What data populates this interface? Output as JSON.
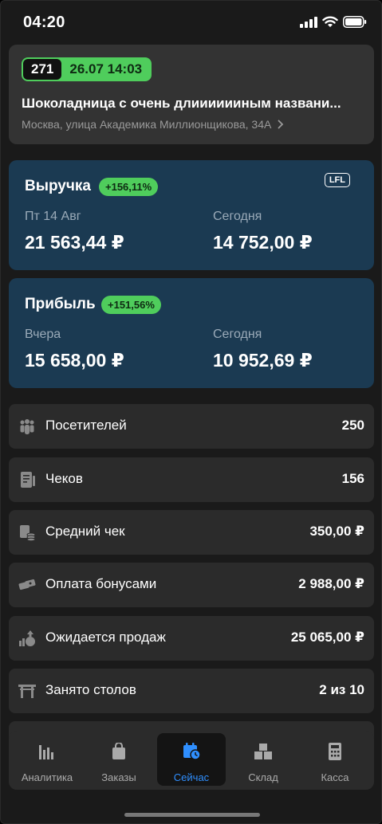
{
  "status": {
    "time": "04:20"
  },
  "store": {
    "number": "271",
    "datetime": "26.07  14:03",
    "name": "Шоколадница с очень длииииииным названи...",
    "address": "Москва, улица Академика Миллионщикова, 34А"
  },
  "revenue": {
    "title": "Выручка",
    "change": "+156,11%",
    "lfl": "LFL",
    "left_label": "Пт 14 Авг",
    "left_value": "21 563,44 ₽",
    "right_label": "Сегодня",
    "right_value": "14 752,00 ₽"
  },
  "profit": {
    "title": "Прибыль",
    "change": "+151,56%",
    "left_label": "Вчера",
    "left_value": "15 658,00 ₽",
    "right_label": "Сегодня",
    "right_value": "10 952,69 ₽"
  },
  "rows": [
    {
      "icon": "visitors-icon",
      "label": "Посетителей",
      "value": "250"
    },
    {
      "icon": "receipt-icon",
      "label": "Чеков",
      "value": "156"
    },
    {
      "icon": "wallet-coins-icon",
      "label": "Средний чек",
      "value": "350,00 ₽"
    },
    {
      "icon": "bonus-tickets-icon",
      "label": "Оплата бонусами",
      "value": "2 988,00 ₽"
    },
    {
      "icon": "sales-forecast-icon",
      "label": "Ожидается продаж",
      "value": "25 065,00 ₽"
    },
    {
      "icon": "table-icon",
      "label": "Занято столов",
      "value": "2 из 10"
    }
  ],
  "tabs": [
    {
      "icon": "bar-chart-icon",
      "label": "Аналитика"
    },
    {
      "icon": "shopping-bag-icon",
      "label": "Заказы"
    },
    {
      "icon": "calendar-clock-icon",
      "label": "Сейчас",
      "active": true
    },
    {
      "icon": "boxes-icon",
      "label": "Склад"
    },
    {
      "icon": "cash-register-icon",
      "label": "Касса"
    }
  ],
  "colors": {
    "accent_green": "#4fcd5c",
    "card_blue": "#1b3a52",
    "active_tab": "#2f8fff"
  }
}
